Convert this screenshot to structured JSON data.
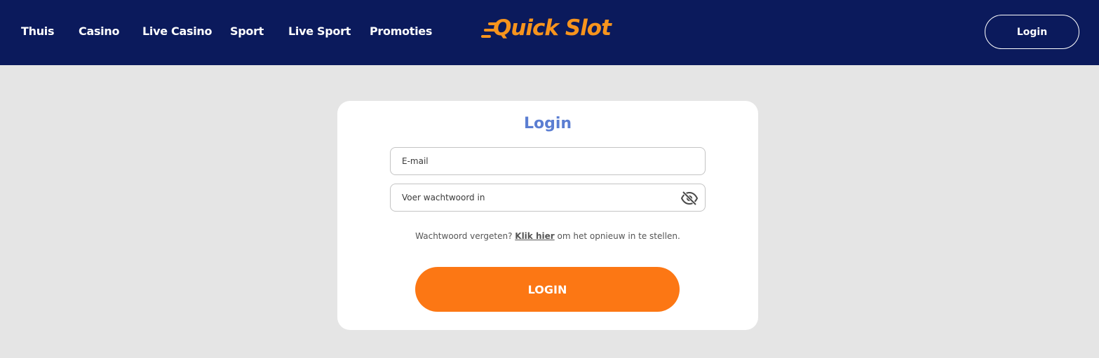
{
  "header": {
    "nav": [
      {
        "label": "Thuis"
      },
      {
        "label": "Casino"
      },
      {
        "label": "Live Casino"
      },
      {
        "label": "Sport"
      },
      {
        "label": "Live Sport"
      },
      {
        "label": "Promoties"
      }
    ],
    "logo_text": "Quick Slot",
    "login_label": "Login"
  },
  "login_form": {
    "title": "Login",
    "email_placeholder": "E-mail",
    "password_placeholder": "Voer wachtwoord in",
    "password_toggle_icon": "eye-off-icon",
    "forgot_prefix": "Wachtwoord vergeten?",
    "forgot_link": "Klik hier",
    "forgot_suffix": "om het opnieuw in te stellen.",
    "submit_label": "LOGIN"
  },
  "colors": {
    "header_bg": "#0b1a5c",
    "accent_orange": "#fc7714",
    "title_blue": "#5b7ed2",
    "page_bg": "#e5e5e5"
  }
}
